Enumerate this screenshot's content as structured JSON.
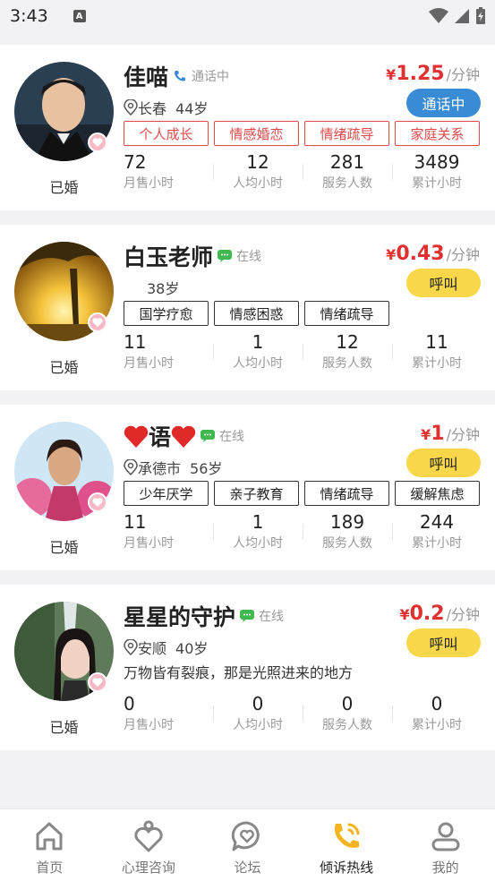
{
  "status_bar": {
    "time": "3:43",
    "indicator": "A"
  },
  "counselors": [
    {
      "name": "佳喵",
      "status": "通话中",
      "status_icon": "phone-icon",
      "location": "长春",
      "age": "44岁",
      "price_currency": "¥",
      "price_value": "1.25",
      "price_unit": "/分钟",
      "call_label": "通话中",
      "marital": "已婚",
      "tags": [
        "个人成长",
        "情感婚恋",
        "情绪疏导",
        "家庭关系"
      ],
      "stats": [
        {
          "value": "72",
          "label": "月售小时"
        },
        {
          "value": "12",
          "label": "人均小时"
        },
        {
          "value": "281",
          "label": "服务人数"
        },
        {
          "value": "3489",
          "label": "累计小时"
        }
      ]
    },
    {
      "name": "白玉老师",
      "status": "在线",
      "status_icon": "chat-icon",
      "location": "",
      "age": "38岁",
      "price_currency": "¥",
      "price_value": "0.43",
      "price_unit": "/分钟",
      "call_label": "呼叫",
      "marital": "已婚",
      "tags": [
        "国学疗愈",
        "情感困惑",
        "情绪疏导"
      ],
      "stats": [
        {
          "value": "11",
          "label": "月售小时"
        },
        {
          "value": "1",
          "label": "人均小时"
        },
        {
          "value": "12",
          "label": "服务人数"
        },
        {
          "value": "11",
          "label": "累计小时"
        }
      ]
    },
    {
      "name": "♥语♥",
      "status": "在线",
      "status_icon": "chat-icon",
      "location": "承德市",
      "age": "56岁",
      "price_currency": "¥",
      "price_value": "1",
      "price_unit": "/分钟",
      "call_label": "呼叫",
      "marital": "已婚",
      "tags": [
        "少年厌学",
        "亲子教育",
        "情绪疏导",
        "缓解焦虑"
      ],
      "stats": [
        {
          "value": "11",
          "label": "月售小时"
        },
        {
          "value": "1",
          "label": "人均小时"
        },
        {
          "value": "189",
          "label": "服务人数"
        },
        {
          "value": "244",
          "label": "累计小时"
        }
      ]
    },
    {
      "name": "星星的守护",
      "status": "在线",
      "status_icon": "chat-icon",
      "location": "安顺",
      "age": "40岁",
      "motto": "万物皆有裂痕，那是光照进来的地方",
      "price_currency": "¥",
      "price_value": "0.2",
      "price_unit": "/分钟",
      "call_label": "呼叫",
      "marital": "已婚",
      "tags": [],
      "stats": [
        {
          "value": "0",
          "label": "月售小时"
        },
        {
          "value": "0",
          "label": "人均小时"
        },
        {
          "value": "0",
          "label": "服务人数"
        },
        {
          "value": "0",
          "label": "累计小时"
        }
      ]
    }
  ],
  "tabbar": {
    "items": [
      {
        "label": "首页",
        "icon": "home-icon"
      },
      {
        "label": "心理咨询",
        "icon": "heart-person-icon"
      },
      {
        "label": "论坛",
        "icon": "chat-heart-icon"
      },
      {
        "label": "倾诉热线",
        "icon": "phone-active-icon"
      },
      {
        "label": "我的",
        "icon": "profile-icon"
      }
    ],
    "active_index": 3
  },
  "colors": {
    "accent_red": "#e03030",
    "call_yellow": "#f8d84a",
    "busy_blue": "#3a8bd6",
    "active_tab": "#f5b320"
  }
}
